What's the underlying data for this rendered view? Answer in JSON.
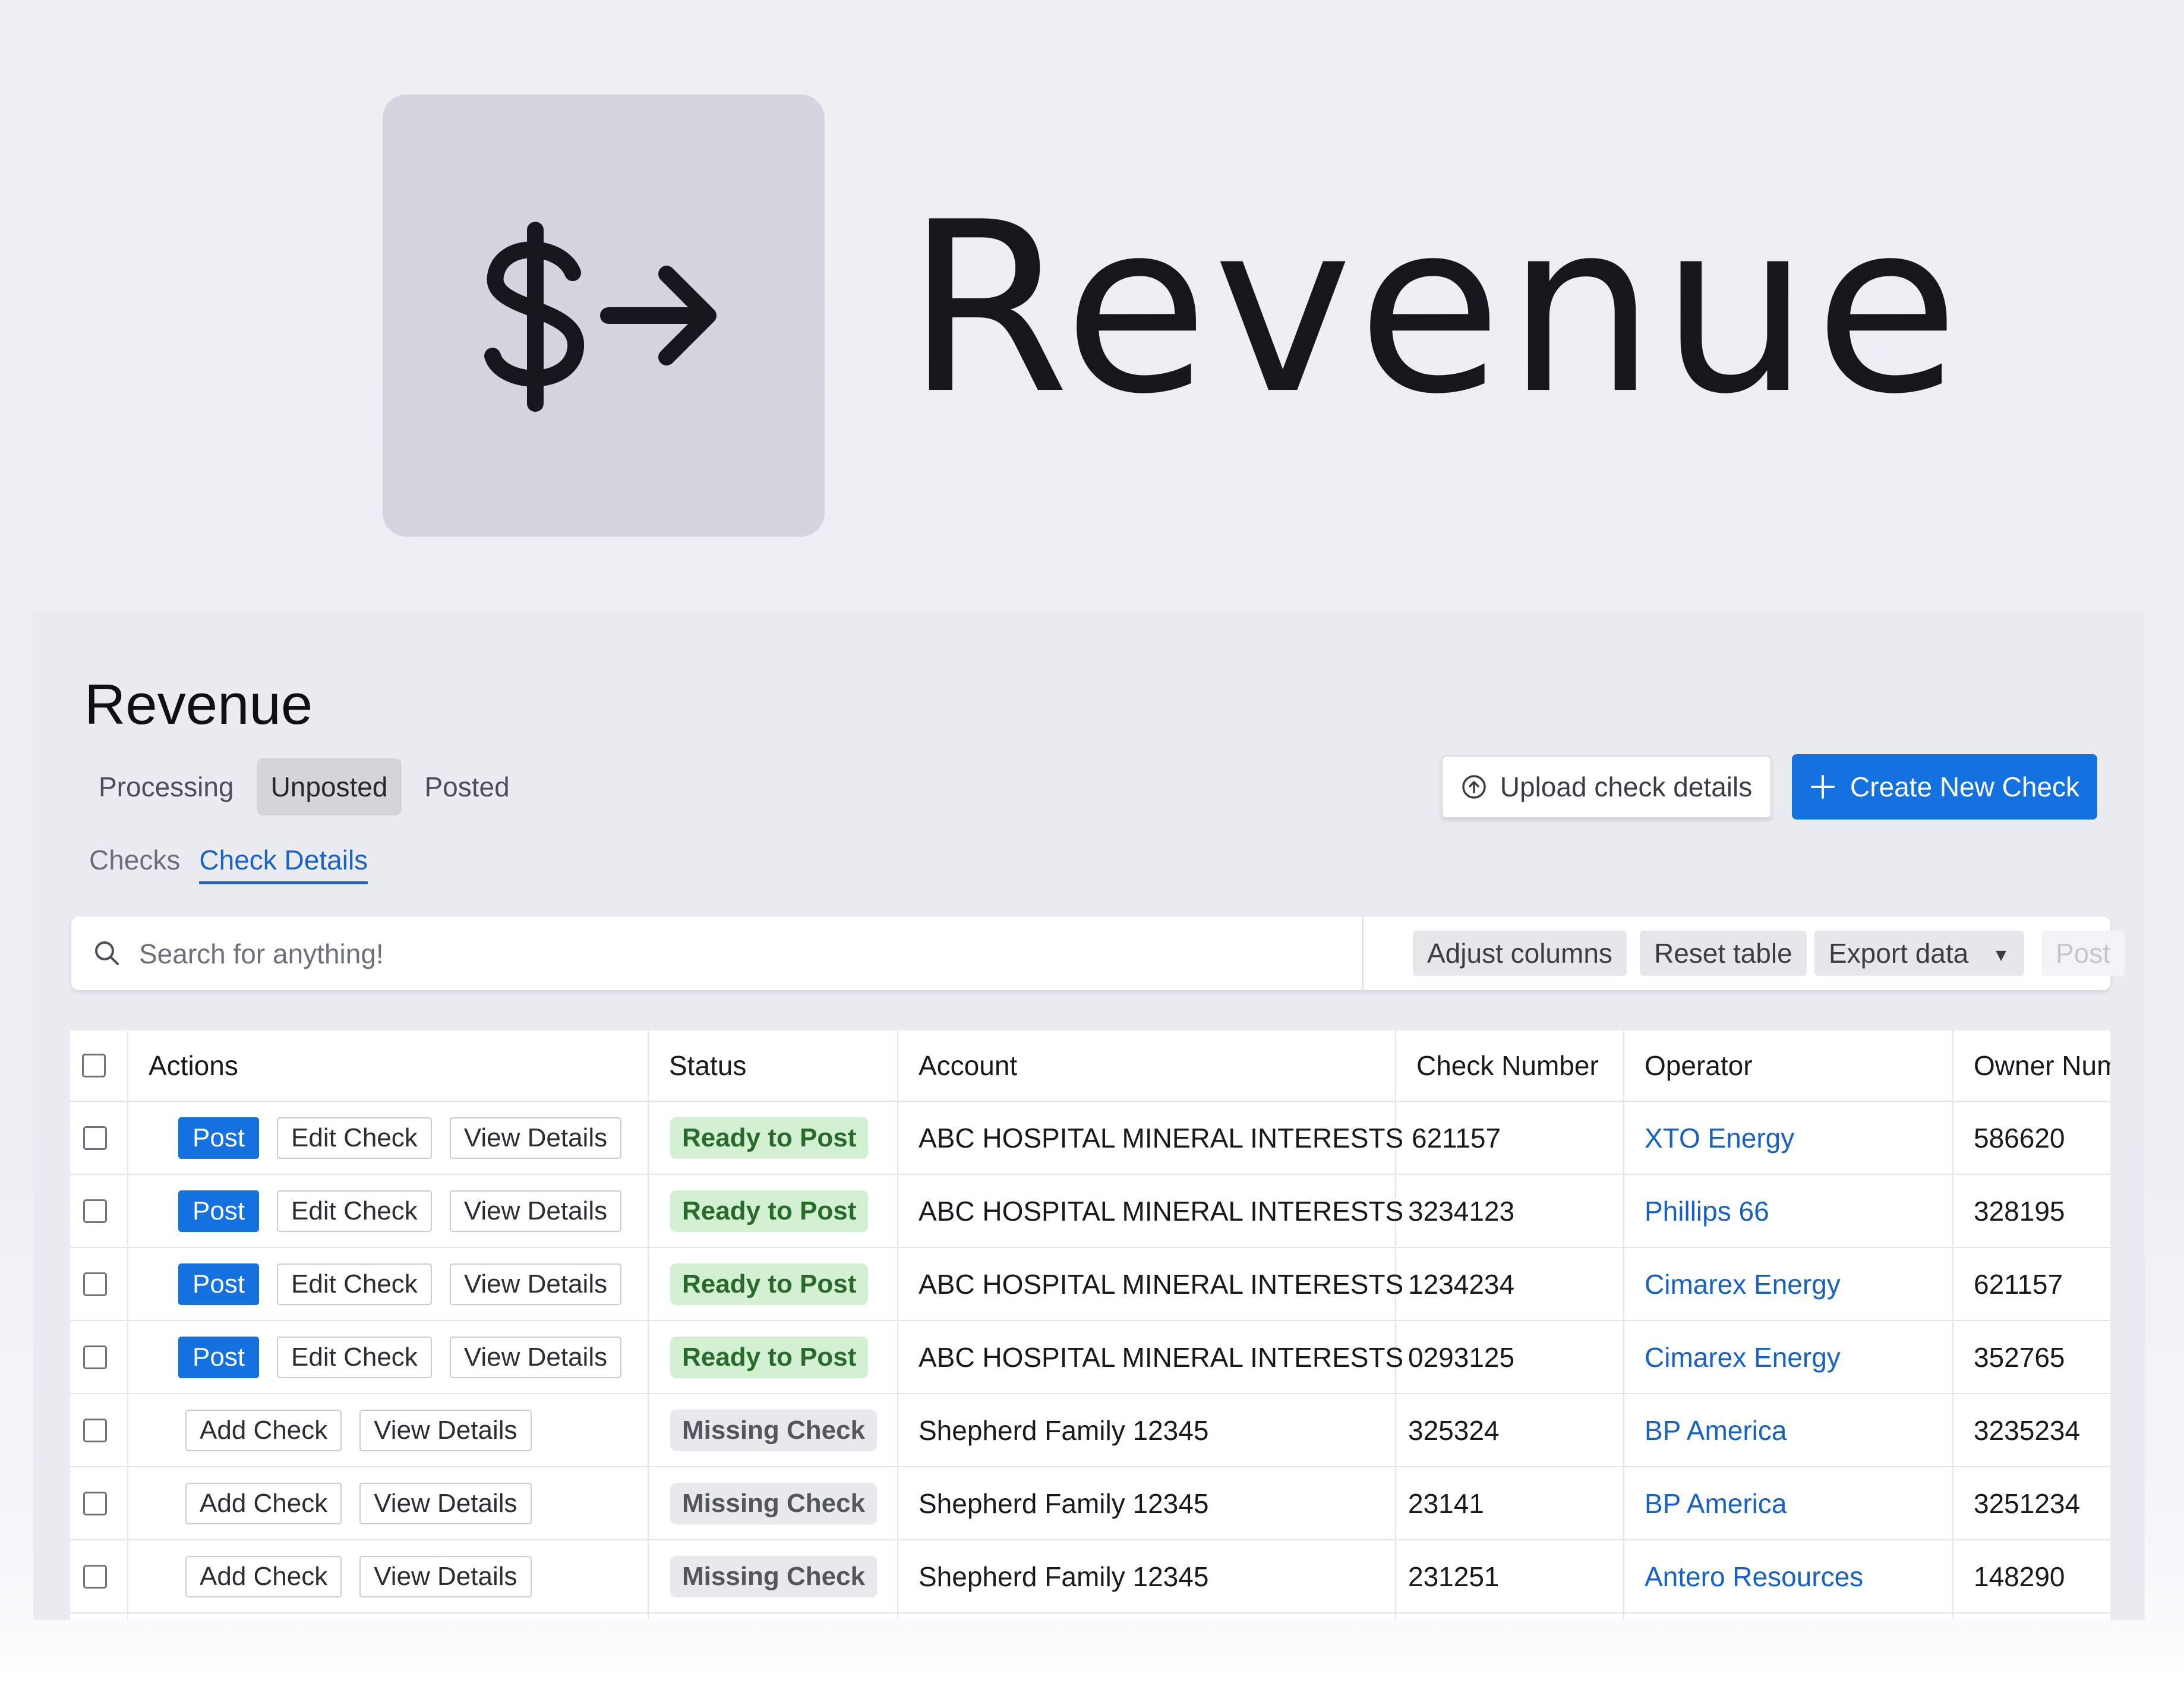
{
  "hero": {
    "title": "Revenue",
    "icon": "dollar-arrow-right-icon"
  },
  "page": {
    "title": "Revenue",
    "primary_tabs": [
      {
        "label": "Processing",
        "active": false
      },
      {
        "label": "Unposted",
        "active": true
      },
      {
        "label": "Posted",
        "active": false
      }
    ],
    "secondary_tabs": [
      {
        "label": "Checks",
        "active": false
      },
      {
        "label": "Check Details",
        "active": true
      }
    ],
    "upload_button": "Upload check details",
    "create_button": "Create New Check"
  },
  "toolbar": {
    "search_placeholder": "Search for anything!",
    "adjust_columns": "Adjust columns",
    "reset_table": "Reset table",
    "export_data": "Export data",
    "post": "Post"
  },
  "table": {
    "headers": {
      "actions": "Actions",
      "status": "Status",
      "account": "Account",
      "check_number": "Check Number",
      "operator": "Operator",
      "owner_number": "Owner Numbe"
    },
    "rows": [
      {
        "actions": [
          "Post",
          "Edit Check",
          "View Details"
        ],
        "status": "Ready to Post",
        "account": "ABC HOSPITAL MINERAL INTERESTS",
        "check_number": "621157",
        "operator": "XTO Energy",
        "owner_number": "586620"
      },
      {
        "actions": [
          "Post",
          "Edit Check",
          "View Details"
        ],
        "status": "Ready to Post",
        "account": "ABC HOSPITAL MINERAL INTERESTS",
        "check_number": "3234123",
        "operator": "Phillips 66",
        "owner_number": "328195"
      },
      {
        "actions": [
          "Post",
          "Edit Check",
          "View Details"
        ],
        "status": "Ready to Post",
        "account": "ABC HOSPITAL MINERAL INTERESTS",
        "check_number": "1234234",
        "operator": "Cimarex Energy",
        "owner_number": "621157"
      },
      {
        "actions": [
          "Post",
          "Edit Check",
          "View Details"
        ],
        "status": "Ready to Post",
        "account": "ABC HOSPITAL MINERAL INTERESTS",
        "check_number": "0293125",
        "operator": "Cimarex Energy",
        "owner_number": "352765"
      },
      {
        "actions": [
          "Add Check",
          "View Details"
        ],
        "status": "Missing Check",
        "account": "Shepherd Family 12345",
        "check_number": "325324",
        "operator": "BP America",
        "owner_number": "3235234"
      },
      {
        "actions": [
          "Add Check",
          "View Details"
        ],
        "status": "Missing Check",
        "account": "Shepherd Family 12345",
        "check_number": "23141",
        "operator": "BP America",
        "owner_number": "3251234"
      },
      {
        "actions": [
          "Add Check",
          "View Details"
        ],
        "status": "Missing Check",
        "account": "Shepherd Family 12345",
        "check_number": "231251",
        "operator": "Antero Resources",
        "owner_number": "148290"
      }
    ]
  },
  "colors": {
    "primary": "#1471e0",
    "link": "#1761c3",
    "ready_bg": "#d3f0d3",
    "ready_text": "#286b2b",
    "missing_bg": "#e8e9ed",
    "missing_text": "#52565d"
  }
}
